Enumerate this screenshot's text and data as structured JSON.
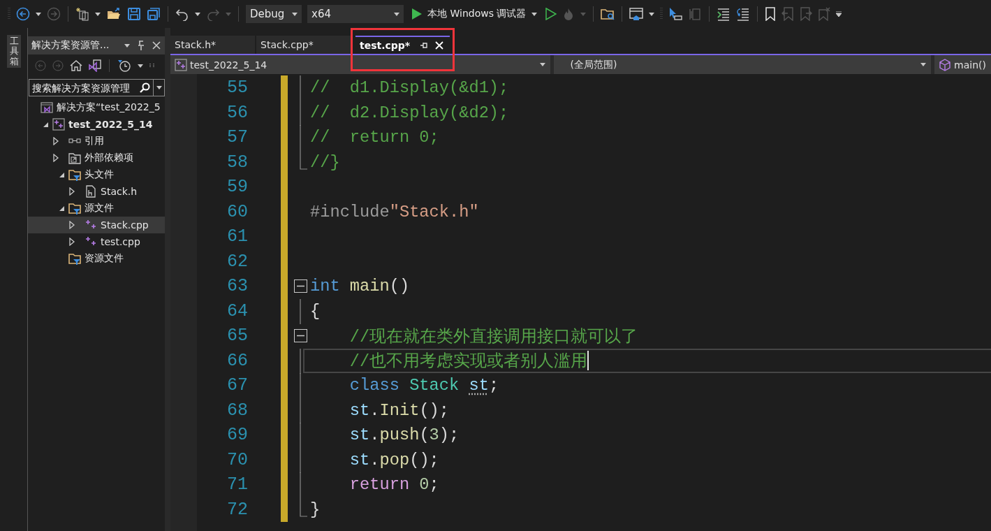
{
  "toolbar": {
    "configuration": "Debug",
    "platform": "x64",
    "debugger": "本地 Windows 调试器"
  },
  "toolbox": {
    "label": "工具箱"
  },
  "solution_explorer": {
    "title": "解决方案资源管...",
    "search_placeholder": "搜索解决方案资源管理",
    "tree": [
      {
        "label": "解决方案“test_2022_5",
        "kind": "solution",
        "selected": false,
        "children": [
          {
            "label": "test_2022_5_14",
            "kind": "project",
            "bold": true,
            "expanded": true,
            "selected": false,
            "children": [
              {
                "label": "引用",
                "kind": "references",
                "expanded": false,
                "selected": false
              },
              {
                "label": "外部依赖项",
                "kind": "external",
                "expanded": false,
                "selected": false
              },
              {
                "label": "头文件",
                "kind": "filter",
                "expanded": true,
                "selected": false,
                "children": [
                  {
                    "label": "Stack.h",
                    "kind": "header",
                    "expanded": false,
                    "selected": false
                  }
                ]
              },
              {
                "label": "源文件",
                "kind": "filter",
                "expanded": true,
                "selected": false,
                "children": [
                  {
                    "label": "Stack.cpp",
                    "kind": "cpp",
                    "expanded": false,
                    "selected": true
                  },
                  {
                    "label": "test.cpp",
                    "kind": "cpp",
                    "expanded": false,
                    "selected": false
                  }
                ]
              },
              {
                "label": "资源文件",
                "kind": "filter",
                "selected": false
              }
            ]
          }
        ]
      }
    ]
  },
  "editor": {
    "tabs": [
      {
        "label": "Stack.h*",
        "selected": false,
        "outlined": false
      },
      {
        "label": "Stack.cpp*",
        "selected": false,
        "outlined": false
      },
      {
        "label": "test.cpp*",
        "selected": true,
        "outlined": true
      }
    ],
    "nav": {
      "project": "test_2022_5_14",
      "scope": "(全局范围)",
      "member": "main()"
    },
    "lines": [
      {
        "number": "55",
        "modified": true,
        "fold_body": true,
        "tokens": [
          {
            "text": "//  d1.Display(&d1);",
            "kind": "comment"
          }
        ]
      },
      {
        "number": "56",
        "modified": true,
        "fold_body": true,
        "tokens": [
          {
            "text": "//  d2.Display(&d2);",
            "kind": "comment"
          }
        ]
      },
      {
        "number": "57",
        "modified": true,
        "fold_body": true,
        "tokens": [
          {
            "text": "//  return 0;",
            "kind": "comment"
          }
        ]
      },
      {
        "number": "58",
        "modified": true,
        "fold_end": true,
        "tokens": [
          {
            "text": "//}",
            "kind": "comment"
          }
        ]
      },
      {
        "number": "59",
        "modified": true
      },
      {
        "number": "60",
        "modified": true,
        "tokens": [
          {
            "text": "#include",
            "kind": "preprocessor"
          },
          {
            "text": "\"Stack.h\"",
            "kind": "string"
          }
        ]
      },
      {
        "number": "61",
        "modified": true
      },
      {
        "number": "62",
        "modified": true
      },
      {
        "number": "63",
        "modified": true,
        "fold_start": true,
        "tokens": [
          {
            "text": "int",
            "kind": "keyword"
          },
          {
            "text": " main",
            "kind": "function"
          },
          {
            "text": "()",
            "kind": "plain"
          }
        ]
      },
      {
        "number": "64",
        "modified": true,
        "fold_body": true,
        "tokens": [
          {
            "text": "{",
            "kind": "plain"
          }
        ]
      },
      {
        "number": "65",
        "modified": true,
        "fold_start": true,
        "tokens": [
          {
            "text": "    //现在就在类外直接调用接口就可以了",
            "kind": "comment"
          }
        ]
      },
      {
        "number": "66",
        "modified": true,
        "fold_body": true,
        "current": true,
        "tokens": [
          {
            "text": "    //也不用考虑实现或者别人滥用",
            "kind": "comment"
          }
        ]
      },
      {
        "number": "67",
        "modified": true,
        "fold_body": true,
        "tokens": [
          {
            "text": "    class",
            "kind": "keyword"
          },
          {
            "text": " Stack ",
            "kind": "type"
          },
          {
            "text": "st",
            "kind": "variable",
            "underlined": true
          },
          {
            "text": ";",
            "kind": "plain"
          }
        ]
      },
      {
        "number": "68",
        "modified": true,
        "fold_body": true,
        "tokens": [
          {
            "text": "    st",
            "kind": "variable"
          },
          {
            "text": ".",
            "kind": "plain"
          },
          {
            "text": "Init",
            "kind": "function"
          },
          {
            "text": "();",
            "kind": "plain"
          }
        ]
      },
      {
        "number": "69",
        "modified": true,
        "fold_body": true,
        "tokens": [
          {
            "text": "    st",
            "kind": "variable"
          },
          {
            "text": ".",
            "kind": "plain"
          },
          {
            "text": "push",
            "kind": "function"
          },
          {
            "text": "(",
            "kind": "plain"
          },
          {
            "text": "3",
            "kind": "number"
          },
          {
            "text": ");",
            "kind": "plain"
          }
        ]
      },
      {
        "number": "70",
        "modified": true,
        "fold_body": true,
        "tokens": [
          {
            "text": "    st",
            "kind": "variable"
          },
          {
            "text": ".",
            "kind": "plain"
          },
          {
            "text": "pop",
            "kind": "function"
          },
          {
            "text": "();",
            "kind": "plain"
          }
        ]
      },
      {
        "number": "71",
        "modified": true,
        "fold_body": true,
        "tokens": [
          {
            "text": "    return",
            "kind": "control"
          },
          {
            "text": " 0",
            "kind": "number"
          },
          {
            "text": ";",
            "kind": "plain"
          }
        ]
      },
      {
        "number": "72",
        "modified": true,
        "fold_end": true,
        "tokens": [
          {
            "text": "}",
            "kind": "plain"
          }
        ]
      }
    ]
  }
}
